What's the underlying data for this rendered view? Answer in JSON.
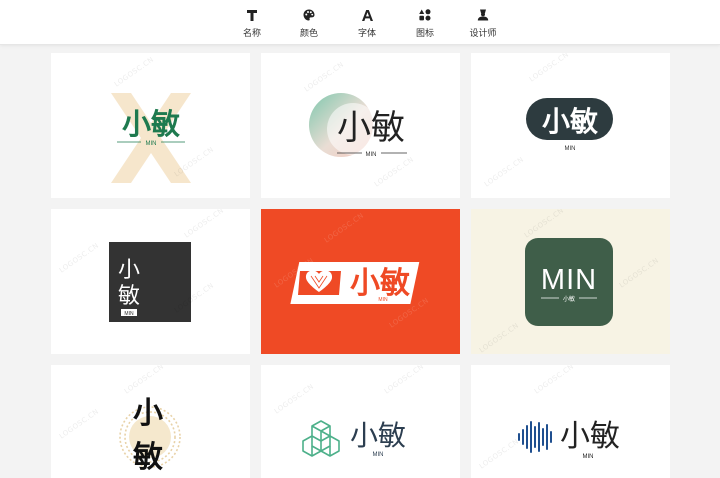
{
  "toolbar": {
    "tabs": [
      {
        "label": "名称",
        "icon": "text-icon"
      },
      {
        "label": "颜色",
        "icon": "palette-icon"
      },
      {
        "label": "字体",
        "icon": "font-icon"
      },
      {
        "label": "图标",
        "icon": "shapes-icon"
      },
      {
        "label": "设计师",
        "icon": "designer-icon"
      }
    ]
  },
  "logo": {
    "name": "小敏",
    "sub": "MIN",
    "mono": "MIN"
  },
  "watermark": "LOGOSC.CN",
  "colors": {
    "page_bg": "#f3f3f3",
    "green": "#1e7a4f",
    "orange_bg": "#ef4a25",
    "cream_bg": "#f7f3e4",
    "dark_green": "#3f5e49",
    "charcoal": "#333333",
    "teal": "#4db08a",
    "navy": "#2c3e50"
  }
}
